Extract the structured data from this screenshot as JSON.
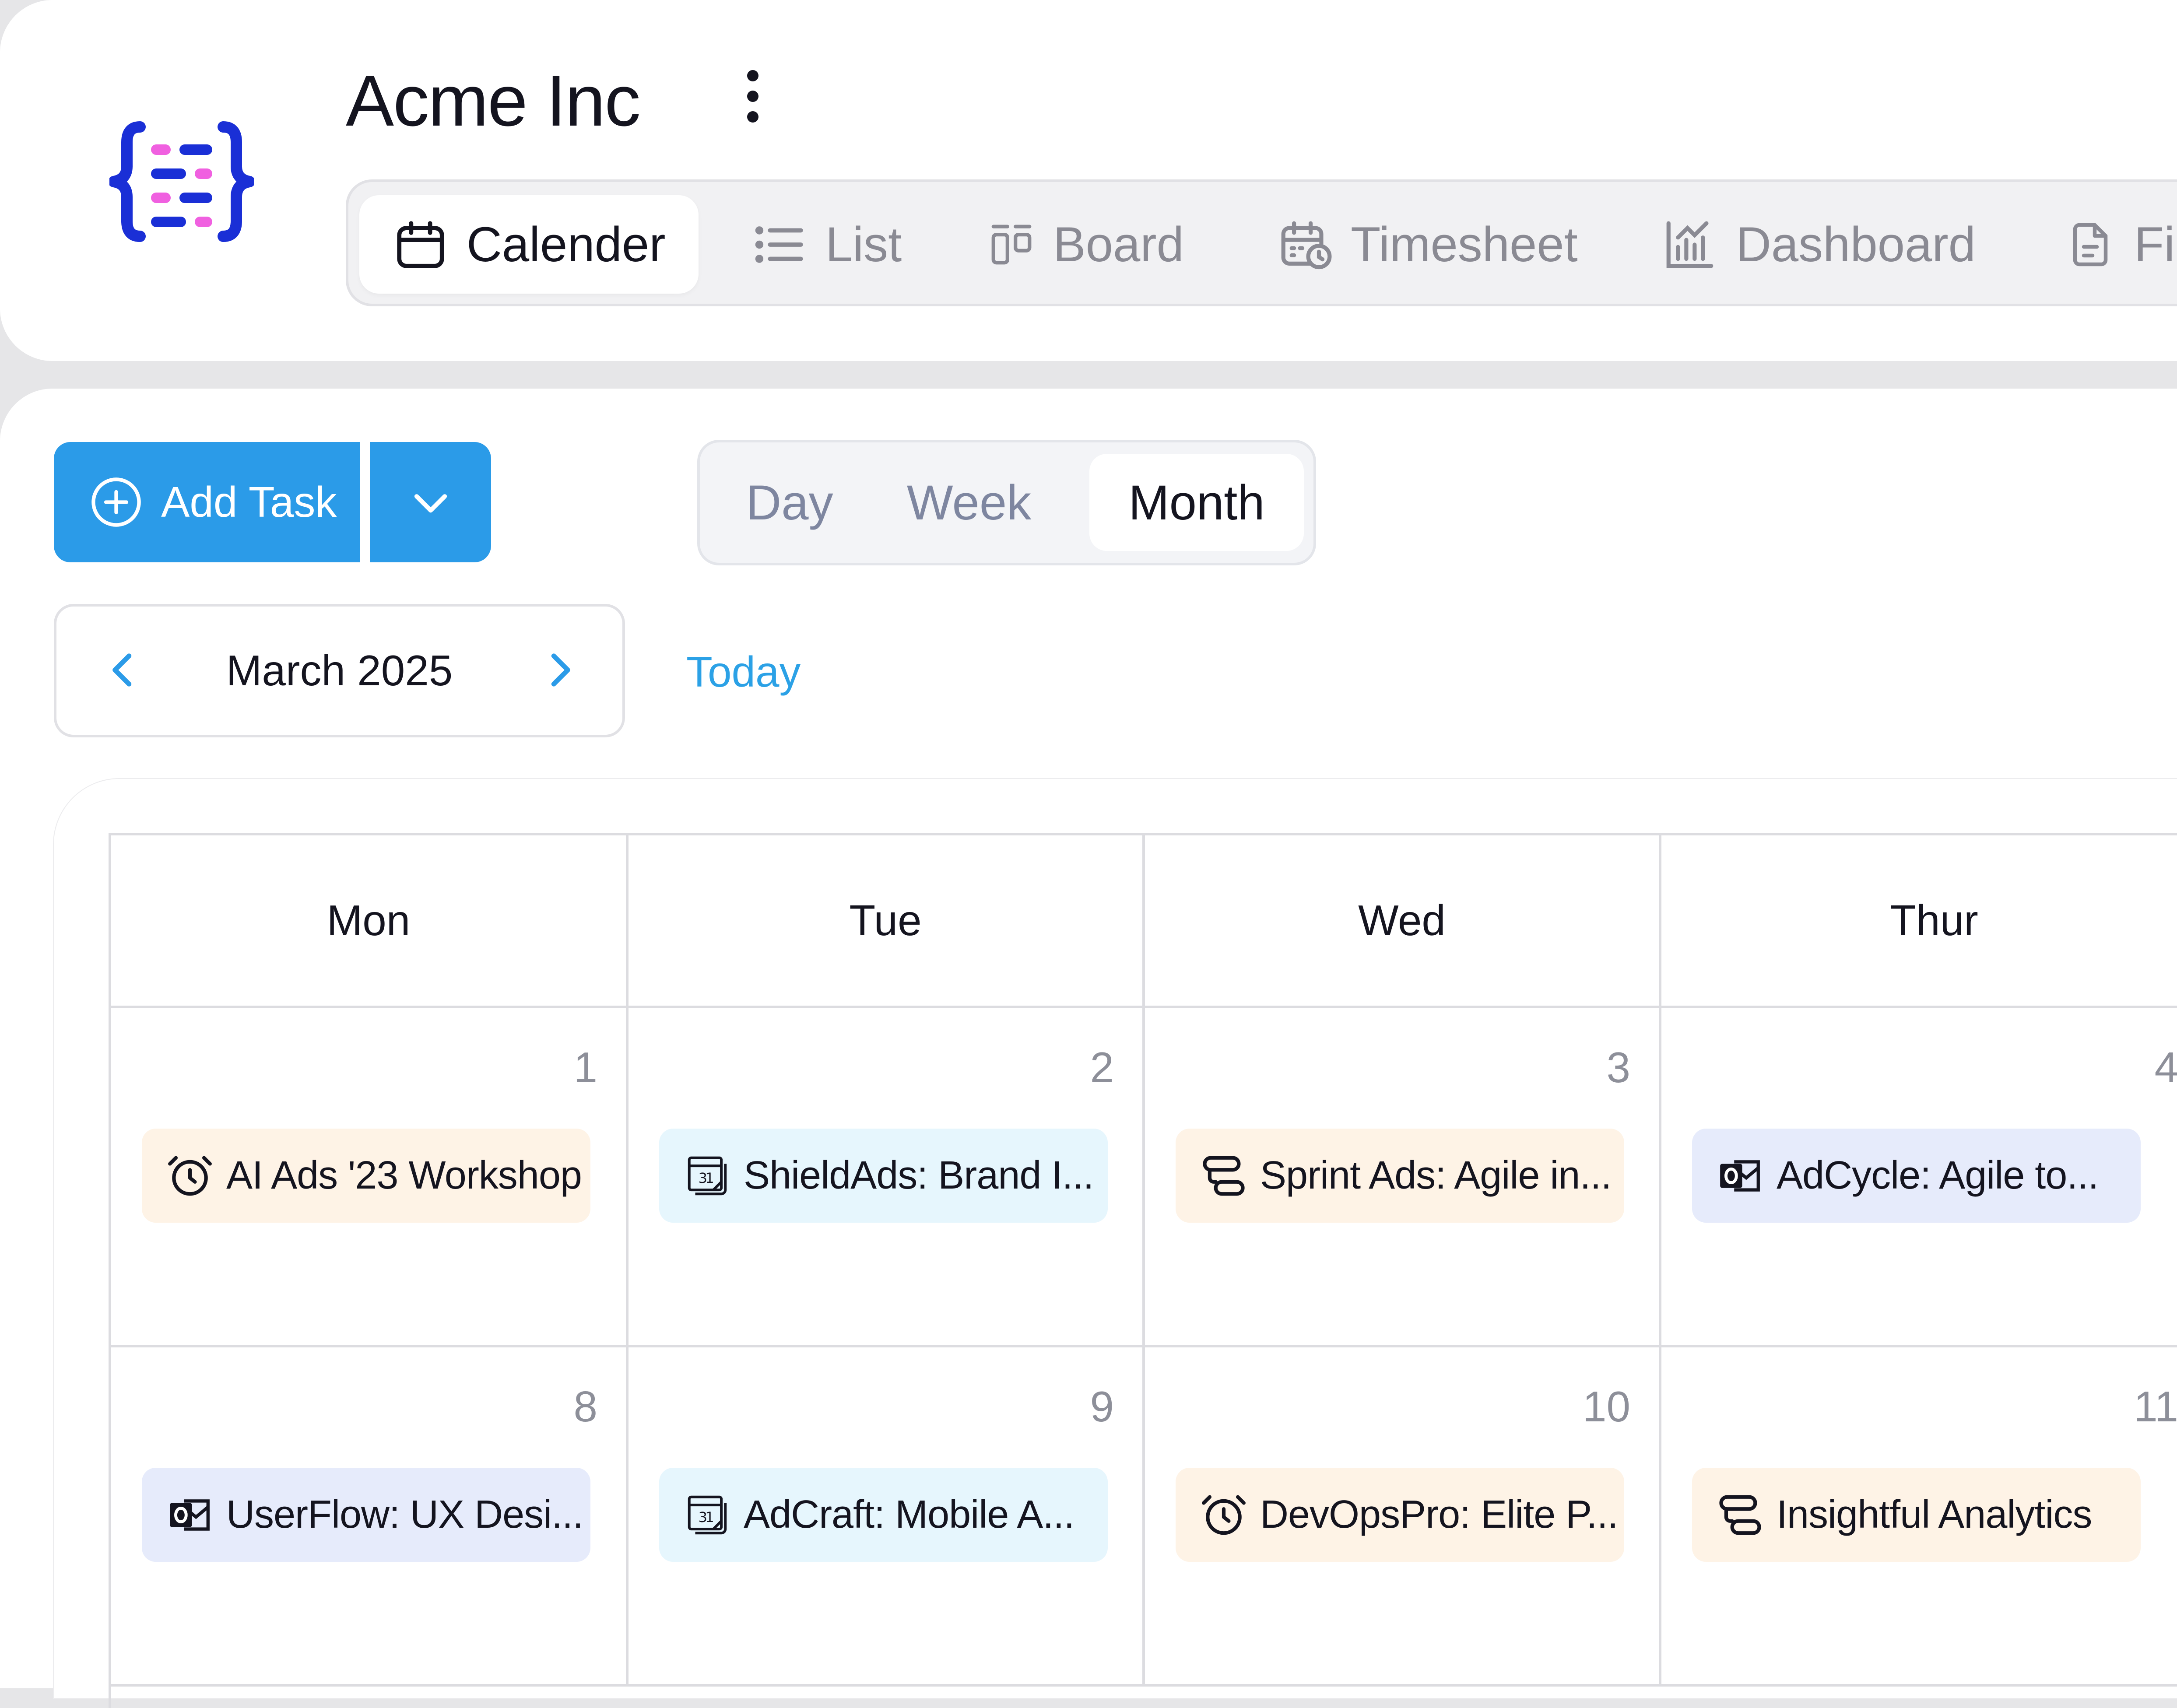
{
  "org": {
    "name": "Acme Inc"
  },
  "tabs": [
    {
      "label": "Calender",
      "icon": "calendar-icon",
      "active": true
    },
    {
      "label": "List",
      "icon": "list-icon"
    },
    {
      "label": "Board",
      "icon": "board-icon"
    },
    {
      "label": "Timesheet",
      "icon": "timesheet-icon"
    },
    {
      "label": "Dashboard",
      "icon": "dashboard-icon"
    },
    {
      "label": "Fi",
      "icon": "file-icon"
    }
  ],
  "toolbar": {
    "add_task_label": "Add Task"
  },
  "views": {
    "day": "Day",
    "week": "Week",
    "month": "Month",
    "active": "month"
  },
  "nav": {
    "month_label": "March 2025",
    "today_label": "Today"
  },
  "calendar": {
    "weekdays": [
      "Mon",
      "Tue",
      "Wed",
      "Thur"
    ],
    "weeks": [
      [
        {
          "date": "1",
          "event": "AI Ads '23 Workshop",
          "icon": "alarm-clock-icon",
          "color": "#fef3e6"
        },
        {
          "date": "2",
          "event": "ShieldAds: Brand I...",
          "icon": "google-calendar-icon",
          "color": "#e6f6fd"
        },
        {
          "date": "3",
          "event": "Sprint Ads: Agile in...",
          "icon": "workflow-icon",
          "color": "#fef3e6"
        },
        {
          "date": "4",
          "event": "AdCycle: Agile to...",
          "icon": "outlook-icon",
          "color": "#e6ebfb"
        }
      ],
      [
        {
          "date": "8",
          "event": "UserFlow: UX Desi...",
          "icon": "outlook-icon",
          "color": "#e6ebfb"
        },
        {
          "date": "9",
          "event": "AdCraft: Mobile A...",
          "icon": "google-calendar-icon",
          "color": "#e6f6fd"
        },
        {
          "date": "10",
          "event": "DevOpsPro: Elite P...",
          "icon": "alarm-clock-icon",
          "color": "#fef3e6"
        },
        {
          "date": "11",
          "event": "Insightful Analytics",
          "icon": "workflow-icon",
          "color": "#fef3e6"
        }
      ]
    ]
  },
  "colors": {
    "accent": "#2b9be8",
    "link": "#2ba1e6",
    "logo_blue": "#1a2fd6",
    "logo_pink": "#f060e0"
  }
}
